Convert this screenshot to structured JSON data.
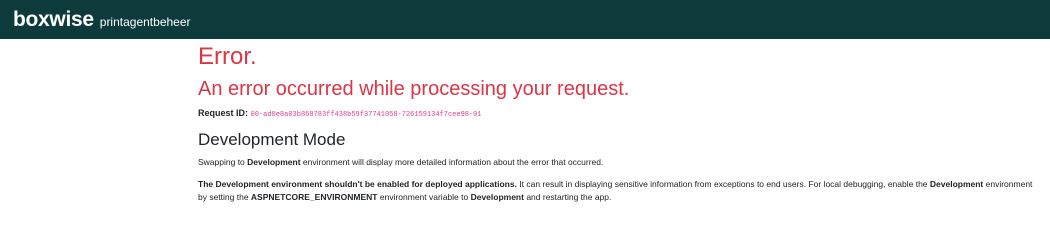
{
  "header": {
    "brand": "boxwise",
    "subtitle": "printagentbeheer"
  },
  "error": {
    "title": "Error.",
    "message": "An error occurred while processing your request.",
    "request_id_label": "Request ID:",
    "request_id": "00-ad0e8a03b868783ff438b59f37741058-726159134f7cee98-01"
  },
  "dev_mode": {
    "heading": "Development Mode",
    "p1": {
      "a": "Swapping to ",
      "b": "Development",
      "c": " environment will display more detailed information about the error that occurred."
    },
    "p2": {
      "a": "The Development environment shouldn't be enabled for deployed applications.",
      "b": " It can result in displaying sensitive information from exceptions to end users. For local debugging, enable the ",
      "c": "Development",
      "d": " environment by setting the ",
      "e": "ASPNETCORE_ENVIRONMENT",
      "f": " environment variable to ",
      "g": "Development",
      "h": " and restarting the app."
    }
  },
  "colors": {
    "navbar_bg": "#0d3b3c",
    "error_red": "#dc3545",
    "code_pink": "#e83e8c"
  }
}
